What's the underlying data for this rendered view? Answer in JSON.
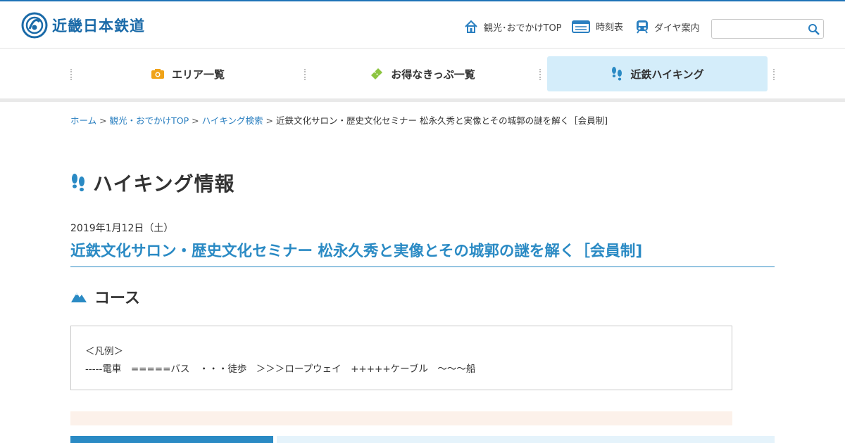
{
  "header": {
    "logo_text": "近畿日本鉄道",
    "util_links": [
      {
        "label": "観光･おでかけTOP",
        "icon": "house-icon"
      },
      {
        "label": "時刻表",
        "icon": "timetable-icon"
      },
      {
        "label": "ダイヤ案内",
        "icon": "train-icon"
      }
    ],
    "search": {
      "placeholder": "",
      "value": ""
    }
  },
  "gnav": {
    "items": [
      {
        "label": "エリア一覧",
        "icon": "camera-icon",
        "color": "#f0a318"
      },
      {
        "label": "お得なきっぷ一覧",
        "icon": "ticket-icon",
        "color": "#8cc540"
      },
      {
        "label": "近鉄ハイキング",
        "icon": "footprints-icon",
        "color": "#2a8ac4",
        "active": true
      }
    ]
  },
  "breadcrumb": {
    "items": [
      "ホーム",
      "観光・おでかけTOP",
      "ハイキング検索"
    ],
    "current": "近鉄文化サロン・歴史文化セミナー 松永久秀と実像とその城郭の謎を解く［会員制]"
  },
  "page": {
    "title": "ハイキング情報",
    "date": "2019年1月12日（土）",
    "event_title": "近鉄文化サロン・歴史文化セミナー 松永久秀と実像とその城郭の謎を解く［会員制]",
    "course_heading": "コース",
    "legend": {
      "title": "＜凡例＞",
      "line": "-----電車　=====バス　・・・徒歩　＞＞＞ロープウェイ　+++++ケーブル　〜〜〜船"
    }
  },
  "colors": {
    "brand": "#1a6aa8",
    "accent": "#2a8ac4",
    "area": "#f0a318",
    "ticket": "#8cc540",
    "active_tab_bg": "#d4edfa"
  }
}
